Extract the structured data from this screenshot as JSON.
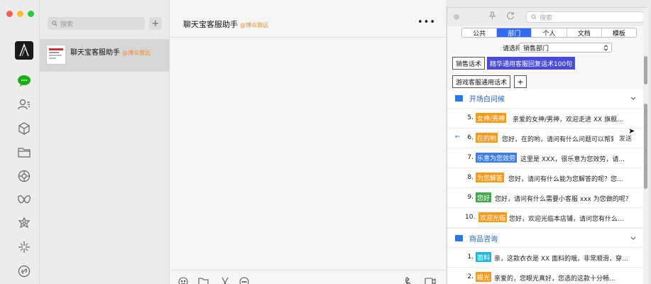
{
  "chat": {
    "search_placeholder": "搜索",
    "add_label": "+",
    "conversation": {
      "name": "聊天宝客服助手",
      "org": "@博众致远"
    },
    "title": "聊天宝客服助手",
    "title_org": "@博众致远",
    "more": "•••"
  },
  "plugin": {
    "search_placeholder": "搜索",
    "tabs": [
      {
        "label": "公共"
      },
      {
        "label": "部门"
      },
      {
        "label": "个人"
      },
      {
        "label": "文档"
      },
      {
        "label": "模板"
      }
    ],
    "dept_label": "请选择部门",
    "dept_value": "销售部门",
    "categories": [
      {
        "label": "销售话术"
      },
      {
        "label": "精华通用客服回复话术100句"
      },
      {
        "label": "游戏客服通用话术"
      }
    ],
    "add_category": "+",
    "send_label": "发送",
    "sections": [
      {
        "title": "开场白问候"
      },
      {
        "title": "商品咨询"
      }
    ],
    "rows": [
      {
        "num": "5.",
        "tag": "女神/男神",
        "text": "亲爱的女神/男神，欢迎走进 XX 旗舰..."
      },
      {
        "num": "6.",
        "tag": "在的哟",
        "text": "您好，在的哟，请问有什么问题可以帮到"
      },
      {
        "num": "7.",
        "tag": "乐意为您效劳",
        "text": "这里是 XXX，很乐意为您效劳，请..."
      },
      {
        "num": "8.",
        "tag": "为您解答",
        "text": "您好，请问有什么能为您解答的呢？您..."
      },
      {
        "num": "9.",
        "tag": "您好",
        "text": "您好，请问有什么需要小客服 xxx 为您做的呢？"
      },
      {
        "num": "10.",
        "tag": "欢迎光临",
        "text": "您好，欢迎光临本店铺，请问您有什么..."
      },
      {
        "num": "1.",
        "tag": "面料",
        "text": "亲，这款衣衣是 XX 面料的哦，非常顺滑，穿..."
      },
      {
        "num": "2.",
        "tag": "眼光",
        "text": "亲爱的，您眼光真好，您选的这款十分畅..."
      }
    ]
  }
}
